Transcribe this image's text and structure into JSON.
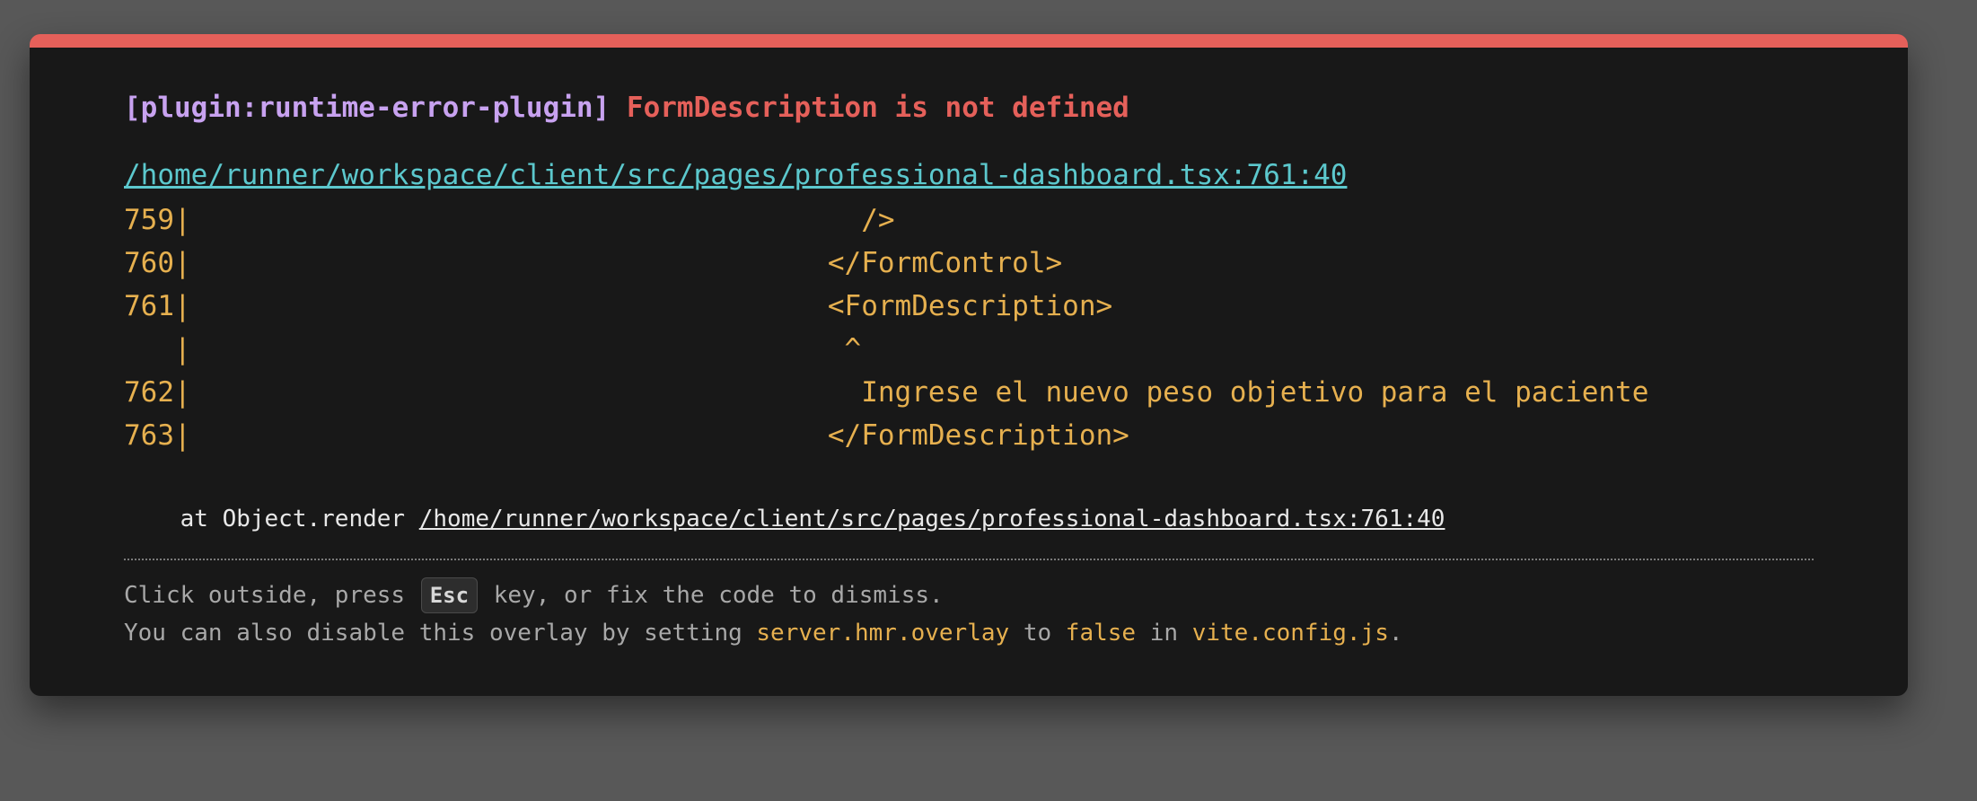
{
  "overlay": {
    "plugin_tag": "[plugin:runtime-error-plugin]",
    "message": "FormDescription is not defined",
    "file_link": "/home/runner/workspace/client/src/pages/professional-dashboard.tsx:761:40",
    "frame_lines": [
      "759|                                        />",
      "760|                                      </FormControl>",
      "761|                                      <FormDescription>",
      "   |                                       ^",
      "762|                                        Ingrese el nuevo peso objetivo para el paciente",
      "763|                                      </FormDescription>"
    ],
    "stack_prefix": "    at Object.render ",
    "stack_link": "/home/runner/workspace/client/src/pages/professional-dashboard.tsx:761:40",
    "tip1_a": "Click outside, press ",
    "tip1_key": "Esc",
    "tip1_b": " key, or fix the code to dismiss.",
    "tip2_a": "You can also disable this overlay by setting ",
    "tip2_code1": "server.hmr.overlay",
    "tip2_b": " to ",
    "tip2_code2": "false",
    "tip2_c": " in ",
    "tip2_code3": "vite.config.js",
    "tip2_d": ".",
    "colors": {
      "accent": "#e5605a",
      "plugin": "#c8a2f0",
      "link": "#5cc8cd",
      "code": "#e6b04f",
      "background": "#181818"
    }
  }
}
